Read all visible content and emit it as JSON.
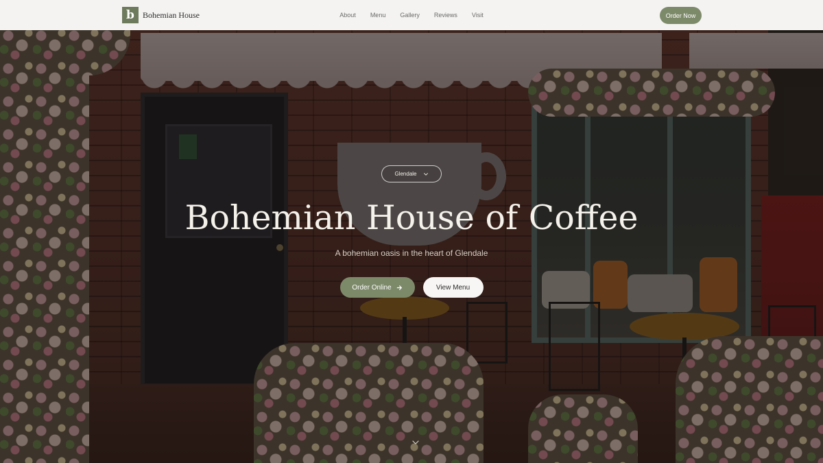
{
  "brand": {
    "logo_letter": "b",
    "name": "Bohemian House"
  },
  "nav": {
    "links": [
      "About",
      "Menu",
      "Gallery",
      "Reviews",
      "Visit"
    ],
    "cta_label": "Order Now"
  },
  "hero": {
    "location_selector": "Glendale",
    "title": "Bohemian House of Coffee",
    "subtitle": "A bohemian oasis in the heart of Glendale",
    "primary_button": "Order Online",
    "secondary_button": "View Menu",
    "background_image": "cafe-storefront-photo"
  },
  "icons": {
    "location_chevron": "chevron-down-icon",
    "order_arrow": "arrow-right-icon",
    "scroll": "chevron-down-icon"
  },
  "colors": {
    "accent": "#7d8a6a",
    "logo_bg": "#6e7a5c",
    "nav_bg": "#f4f3f1",
    "hero_text": "#f5f1eb"
  }
}
